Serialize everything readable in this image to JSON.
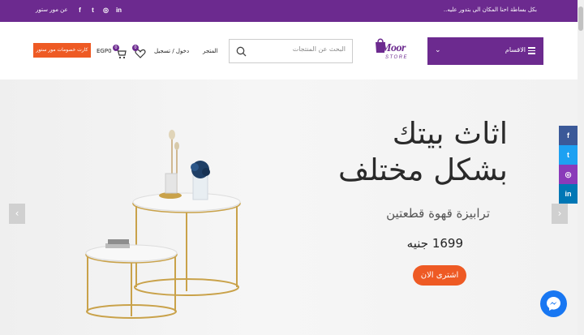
{
  "topbar": {
    "tagline": "بكل بساطة احنا المكان الى بتدور عليه..",
    "about": "عن مور ستور",
    "socials": [
      {
        "icon": "facebook-icon",
        "glyph": "f"
      },
      {
        "icon": "twitter-icon",
        "glyph": "t"
      },
      {
        "icon": "instagram-icon",
        "glyph": "◎"
      },
      {
        "icon": "linkedin-icon",
        "glyph": "in"
      }
    ]
  },
  "header": {
    "categories_label": "الاقسام",
    "logo_word": "Moor",
    "logo_sub": "STORE",
    "search_placeholder": "البحث عن المنتجات",
    "store_link": "المتجر",
    "login_link": "دخول / تسجيل",
    "wishlist_count": "0",
    "cart_count": "0",
    "cart_total": "EGP0",
    "promo_button": "كارت خصومات مور ستور"
  },
  "hero": {
    "title_line1": "اثاث بيتك",
    "title_line2": "بشكل مختلف",
    "subtitle": "ترابيزة قهوة قطعتين",
    "price": "1699 جنيه",
    "buy_button": "اشترى الان",
    "prev_arrow": "‹",
    "next_arrow": "›"
  },
  "side_socials": [
    {
      "icon": "facebook-icon",
      "glyph": "f",
      "color": "#3b5998"
    },
    {
      "icon": "twitter-icon",
      "glyph": "t",
      "color": "#1da1f2"
    },
    {
      "icon": "instagram-icon",
      "glyph": "◎",
      "color": "#8a3ab9"
    },
    {
      "icon": "linkedin-icon",
      "glyph": "in",
      "color": "#0077b5"
    }
  ],
  "colors": {
    "brand_purple": "#6c2a8f",
    "accent_orange": "#ee5a24",
    "messenger_blue": "#1877f2"
  }
}
